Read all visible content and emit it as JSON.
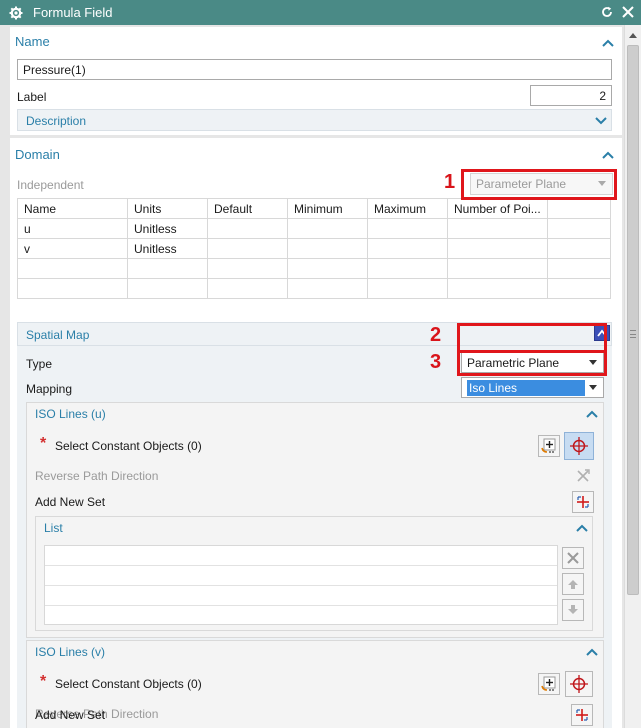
{
  "window": {
    "title": "Formula Field"
  },
  "name_section": {
    "title": "Name",
    "name_value": "Pressure(1)",
    "label_text": "Label",
    "label_value": "2",
    "description_title": "Description"
  },
  "domain_section": {
    "title": "Domain",
    "independent_label": "Independent",
    "independent_value": "Parameter Plane",
    "table": {
      "headers": [
        "Name",
        "Units",
        "Default",
        "Minimum",
        "Maximum",
        "Number of Poi..."
      ],
      "rows": [
        [
          "u",
          "Unitless",
          "",
          "",
          "",
          ""
        ],
        [
          "v",
          "Unitless",
          "",
          "",
          "",
          ""
        ]
      ]
    }
  },
  "spatial_map": {
    "title": "Spatial Map",
    "type_label": "Type",
    "type_value": "Parametric Plane",
    "mapping_label": "Mapping",
    "mapping_value": "Iso Lines"
  },
  "iso_u": {
    "title": "ISO Lines (u)",
    "asterisk": "*",
    "select_label": "Select Constant Objects (0)",
    "reverse_label": "Reverse Path Direction",
    "add_label": "Add New Set",
    "list_title": "List"
  },
  "iso_v": {
    "title": "ISO Lines (v)",
    "asterisk": "*",
    "select_label": "Select Constant Objects (0)",
    "reverse_label": "Reverse Path Direction",
    "add_label": "Add New Set"
  },
  "annotations": {
    "one": "1",
    "two": "2",
    "three": "3"
  },
  "colors": {
    "titlebar": "#4a8a86",
    "accent_text": "#2a7fa8",
    "annotation_red": "#e0161b",
    "selection": "#3b8de0"
  }
}
